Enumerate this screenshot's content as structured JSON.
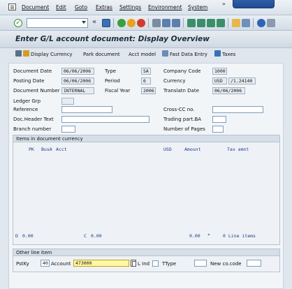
{
  "menubar": {
    "items": [
      "Document",
      "Edit",
      "Goto",
      "Extras",
      "Settings",
      "Environment",
      "System"
    ],
    "more_glyph": "»"
  },
  "toolbar": {
    "back_glyph": "«",
    "icons": [
      "save-icon",
      "back-icon",
      "exit-icon",
      "cancel-icon",
      "print-icon",
      "find-icon",
      "find-next-icon",
      "first-page-icon",
      "prev-page-icon",
      "next-page-icon",
      "last-page-icon",
      "new-session-icon",
      "shortcut-icon",
      "help-icon",
      "customize-icon"
    ]
  },
  "title": "Enter G/L account document: Display Overview",
  "app_toolbar": {
    "display_currency": "Display Currency",
    "park_document": "Park document",
    "acct_model": "Acct model",
    "fast_data_entry": "Fast Data Entry",
    "taxes": "Taxes"
  },
  "header": {
    "document_date_label": "Document Date",
    "document_date": "06/06/2006",
    "type_label": "Type",
    "type": "SA",
    "company_code_label": "Company Code",
    "company_code": "1000",
    "posting_date_label": "Posting Date",
    "posting_date": "06/06/2006",
    "period_label": "Period",
    "period": "6",
    "currency_label": "Currency",
    "currency": "USD",
    "exchange_rate": "/1.24140",
    "document_number_label": "Document Number",
    "document_number": "INTERNAL",
    "fiscal_year_label": "Fiscal Year",
    "fiscal_year": "2006",
    "translation_date_label": "Translatn Date",
    "translation_date": "06/06/2006",
    "ledger_grp_label": "Ledger Grp",
    "reference_label": "Reference",
    "cross_cc_label": "Cross-CC no.",
    "doc_header_text_label": "Doc.Header Text",
    "trading_part_label": "Trading part.BA",
    "branch_number_label": "Branch number",
    "number_of_pages_label": "Number of Pages"
  },
  "items": {
    "title": "Items in document currency",
    "col_pk": "PK",
    "col_busa": "BusA",
    "col_acct": "Acct",
    "col_usd": "USD",
    "col_amount": "Amount",
    "col_tax": "Tax amnt",
    "debit_label": "D",
    "debit_value": "0.00",
    "credit_label": "C",
    "credit_value": "0.00",
    "balance_value": "0.00",
    "balance_flag": "*",
    "line_items": "0 Line items"
  },
  "other_line_item": {
    "title": "Other line item",
    "pstky_label": "PstKy",
    "pstky": "40",
    "account_label": "Account",
    "account": "473000",
    "l_ind_label": "L Ind",
    "ttype_label": "TType",
    "new_cocode_label": "New co.code"
  }
}
